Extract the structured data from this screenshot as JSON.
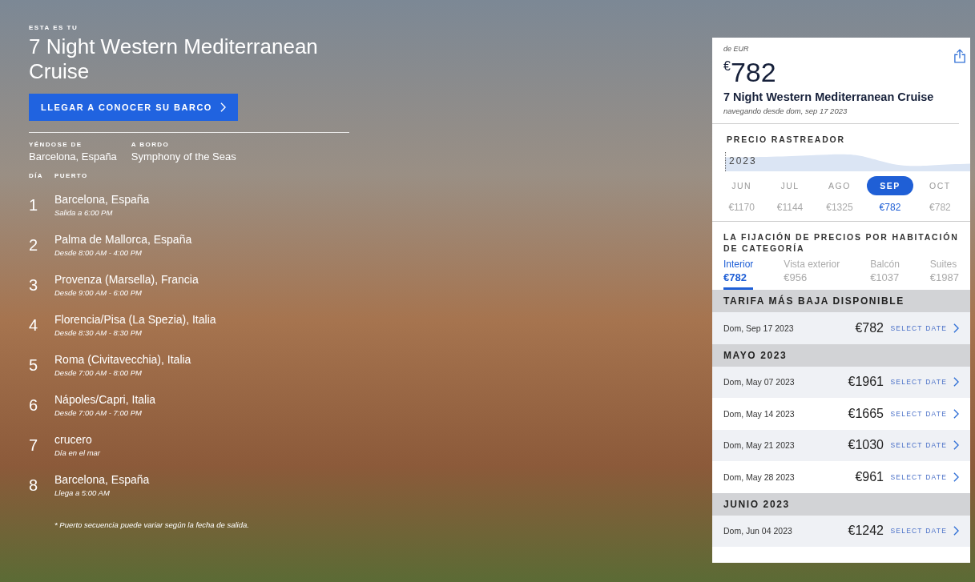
{
  "hero": {
    "eyebrow": "ESTA ES TU",
    "title": "7 Night Western Mediterranean Cruise",
    "cta": "LLEGAR A CONOCER SU BARCO",
    "details": [
      {
        "label": "YÉNDOSE DE",
        "value": "Barcelona, España"
      },
      {
        "label": "A BORDO",
        "value": "Symphony of the Seas"
      }
    ],
    "itinerary_columns": [
      "DÍA",
      "PUERTO"
    ],
    "itinerary": [
      {
        "day": "1",
        "port": "Barcelona, España",
        "time": "Salida a 6:00 PM"
      },
      {
        "day": "2",
        "port": "Palma de Mallorca, España",
        "time": "Desde 8:00 AM - 4:00 PM"
      },
      {
        "day": "3",
        "port": "Provenza (Marsella), Francia",
        "time": "Desde 9:00 AM - 6:00 PM"
      },
      {
        "day": "4",
        "port": "Florencia/Pisa (La Spezia), Italia",
        "time": "Desde 8:30 AM - 8:30 PM"
      },
      {
        "day": "5",
        "port": "Roma (Civitavecchia), Italia",
        "time": "Desde 7:00 AM - 8:00 PM"
      },
      {
        "day": "6",
        "port": "Nápoles/Capri, Italia",
        "time": "Desde 7:00 AM - 7:00 PM"
      },
      {
        "day": "7",
        "port": "crucero",
        "time": "Día en el mar"
      },
      {
        "day": "8",
        "port": "Barcelona, España",
        "time": "Llega a 5:00 AM"
      }
    ],
    "footnote": "* Puerto secuencia puede variar según la fecha de salida."
  },
  "panel": {
    "currency_note": "de EUR",
    "price": "$^{€}$782",
    "title": "7 Night Western Mediterranean Cruise",
    "sailing": "navegando desde dom, sep 17 2023",
    "tracker": {
      "title": "PRECIO RASTREADOR",
      "year": "2023",
      "months": [
        {
          "month": "JUN",
          "price": "€1170",
          "selected": false
        },
        {
          "month": "JUL",
          "price": "€1144",
          "selected": false
        },
        {
          "month": "AGO",
          "price": "€1325",
          "selected": false
        },
        {
          "month": "SEP",
          "price": "€782",
          "selected": true
        },
        {
          "month": "OCT",
          "price": "€782",
          "selected": false
        }
      ]
    },
    "category_title": "LA FIJACIÓN DE PRECIOS POR HABITACIÓN DE CATEGORÍA",
    "categories": [
      {
        "name": "Interior",
        "price": "€782",
        "selected": true
      },
      {
        "name": "Vista exterior",
        "price": "€956",
        "selected": false
      },
      {
        "name": "Balcón",
        "price": "€1037",
        "selected": false
      },
      {
        "name": "Suites",
        "price": "€1987",
        "selected": false
      }
    ],
    "sections": [
      {
        "title": "TARIFA MÁS BAJA DISPONIBLE",
        "rows": [
          {
            "date": "Dom, Sep 17 2023",
            "price": "€782",
            "action": "SELECT DATE"
          }
        ]
      },
      {
        "title": "MAYO 2023",
        "rows": [
          {
            "date": "Dom, May 07 2023",
            "price": "€1961",
            "action": "SELECT DATE"
          },
          {
            "date": "Dom, May 14 2023",
            "price": "€1665",
            "action": "SELECT DATE"
          },
          {
            "date": "Dom, May 21 2023",
            "price": "€1030",
            "action": "SELECT DATE"
          },
          {
            "date": "Dom, May 28 2023",
            "price": "€961",
            "action": "SELECT DATE"
          }
        ]
      },
      {
        "title": "JUNIO 2023",
        "rows": [
          {
            "date": "Dom, Jun 04 2023",
            "price": "€1242",
            "action": "SELECT DATE"
          }
        ]
      }
    ]
  }
}
